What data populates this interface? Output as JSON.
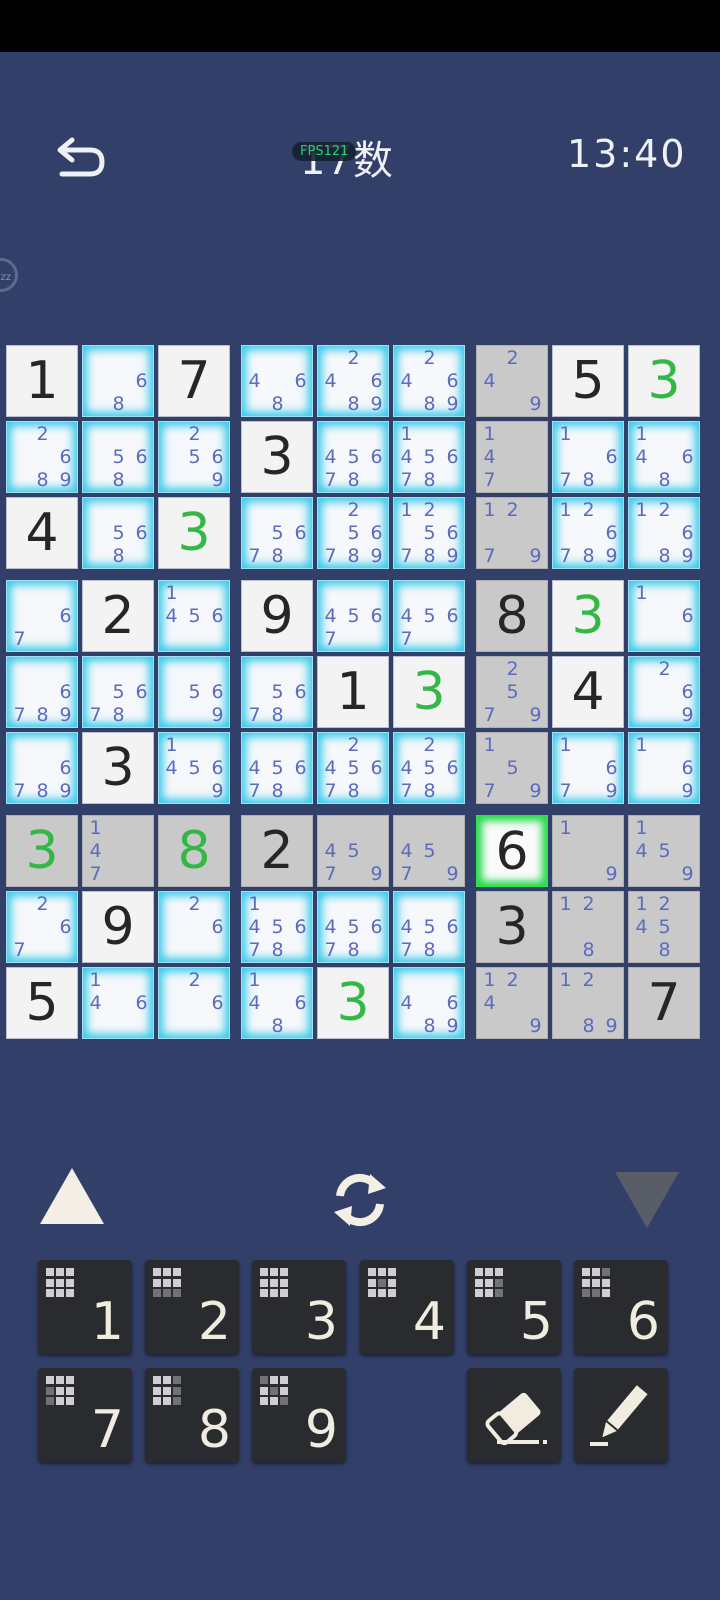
{
  "header": {
    "title": "17数",
    "fps": "FPS121",
    "timer": "13:40",
    "zz": "zz"
  },
  "board": {
    "cells": [
      [
        "G1",
        "C:68",
        "G7",
        "C:468",
        "C:24689",
        "C:24689",
        "X:249",
        "G5",
        "N3"
      ],
      [
        "C:2689",
        "C:568",
        "C:2569",
        "G3",
        "C:45678",
        "C:145678",
        "X:147",
        "C:1678",
        "C:1468"
      ],
      [
        "G4",
        "C:568",
        "N3",
        "C:5678",
        "C:256789",
        "C:1256789",
        "X:1279",
        "C:126789",
        "C:12689"
      ],
      [
        "C:67",
        "G2",
        "C:1456",
        "G9",
        "C:4567",
        "C:4567",
        "Y8",
        "N3",
        "C:16"
      ],
      [
        "C:6789",
        "C:5678",
        "C:569",
        "C:5678",
        "G1",
        "N3",
        "X:2579",
        "G4",
        "C:269"
      ],
      [
        "C:6789",
        "G3",
        "C:14569",
        "C:45678",
        "C:245678",
        "C:245678",
        "X:1579",
        "C:1679",
        "C:169"
      ],
      [
        "M3",
        "X:147",
        "M8",
        "Y2",
        "X:4579",
        "X:4579",
        "S6",
        "X:19",
        "X:1459"
      ],
      [
        "C:267",
        "G9",
        "C:26",
        "C:145678",
        "C:45678",
        "C:45678",
        "Y3",
        "X:128",
        "X:12458"
      ],
      [
        "G5",
        "C:146",
        "C:26",
        "C:1468",
        "N3",
        "C:4689",
        "X:1249",
        "X:1289",
        "Y7"
      ]
    ]
  },
  "controls": {
    "up_icon": "triangle-up-icon",
    "rotate_icon": "rotate-icon",
    "down_icon": "triangle-down-icon"
  },
  "keypad": {
    "keys": [
      "1",
      "2",
      "3",
      "4",
      "5",
      "6",
      "7",
      "8",
      "9"
    ],
    "eraser_icon": "eraser-icon",
    "pencil_icon": "pencil-icon"
  }
}
